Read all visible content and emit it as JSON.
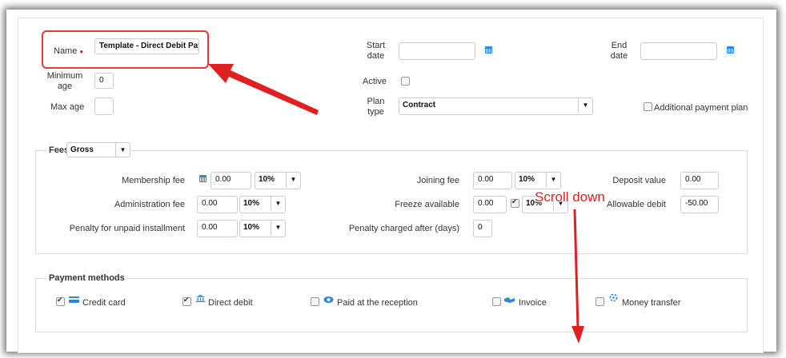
{
  "colors": {
    "accent": "#2e86de",
    "annotation": "#e02020",
    "required": "#d9262b"
  },
  "general": {
    "name_label": "Name",
    "name_value": "Template - Direct Debit Paym",
    "min_age_label_1": "Minimum",
    "min_age_label_2": "age",
    "min_age_value": "0",
    "max_age_label": "Max age",
    "max_age_value": "",
    "start_date_label_1": "Start",
    "start_date_label_2": "date",
    "start_date_value": "",
    "end_date_label_1": "End",
    "end_date_label_2": "date",
    "end_date_value": "",
    "active_label": "Active",
    "active_checked": false,
    "plan_type_label_1": "Plan",
    "plan_type_label_2": "type",
    "plan_type_value": "Contract",
    "additional_plan_label": "Additional payment plan",
    "additional_plan_checked": false
  },
  "fees": {
    "legend": "Fees",
    "type_value": "Gross",
    "membership_fee_label": "Membership fee",
    "membership_fee_value": "0.00",
    "membership_vat": "10%",
    "administration_fee_label": "Administration fee",
    "administration_fee_value": "0.00",
    "administration_vat": "10%",
    "penalty_label": "Penalty for unpaid installment",
    "penalty_value": "0.00",
    "penalty_vat": "10%",
    "joining_fee_label": "Joining fee",
    "joining_fee_value": "0.00",
    "joining_vat": "10%",
    "freeze_label": "Freeze available",
    "freeze_value": "0.00",
    "freeze_checked": true,
    "freeze_vat": "10%",
    "penalty_after_label": "Penalty charged after (days)",
    "penalty_after_value": "0",
    "deposit_label": "Deposit value",
    "deposit_value": "0.00",
    "allowable_debit_label": "Allowable debit",
    "allowable_debit_value": "-50.00"
  },
  "payment_methods": {
    "legend": "Payment methods",
    "items": [
      {
        "label": "Credit card",
        "checked": true,
        "icon": "credit-card-icon"
      },
      {
        "label": "Direct debit",
        "checked": true,
        "icon": "bank-icon"
      },
      {
        "label": "Paid at the reception",
        "checked": false,
        "icon": "money-icon"
      },
      {
        "label": "Invoice",
        "checked": false,
        "icon": "handshake-icon"
      },
      {
        "label": "Money transfer",
        "checked": false,
        "icon": "transfer-icon"
      }
    ]
  },
  "annotation": {
    "scroll_text": "Scroll down"
  }
}
